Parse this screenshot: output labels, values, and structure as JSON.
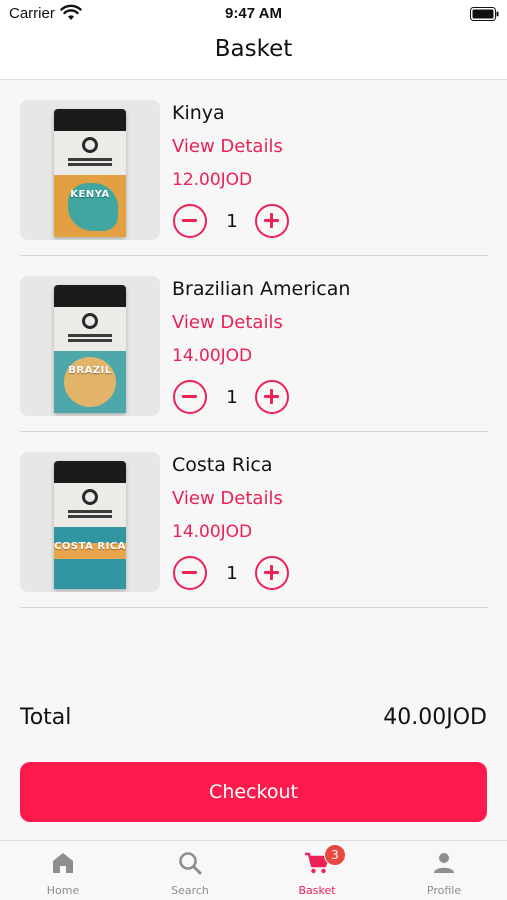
{
  "status_bar": {
    "carrier": "Carrier",
    "time": "9:47 AM"
  },
  "header": {
    "title": "Basket"
  },
  "basket": {
    "items": [
      {
        "name": "Kinya",
        "details_label": "View Details",
        "price": "12.00JOD",
        "quantity": "1",
        "bag_label": "KENYA"
      },
      {
        "name": "Brazilian American",
        "details_label": "View Details",
        "price": "14.00JOD",
        "quantity": "1",
        "bag_label": "BRAZIL"
      },
      {
        "name": "Costa Rica",
        "details_label": "View Details",
        "price": "14.00JOD",
        "quantity": "1",
        "bag_label": "COSTA RICA"
      }
    ]
  },
  "summary": {
    "total_label": "Total",
    "total_value": "40.00JOD",
    "checkout_label": "Checkout"
  },
  "tab_bar": {
    "tabs": [
      {
        "label": "Home",
        "icon": "home-icon"
      },
      {
        "label": "Search",
        "icon": "search-icon"
      },
      {
        "label": "Basket",
        "icon": "cart-icon",
        "badge": "3"
      },
      {
        "label": "Profile",
        "icon": "profile-icon"
      }
    ],
    "active_index": 2
  },
  "colors": {
    "accent": "#ec2154",
    "checkout_button": "#fd1a4c",
    "badge": "#e8483f",
    "inactive_tab": "#8e8e8e"
  }
}
